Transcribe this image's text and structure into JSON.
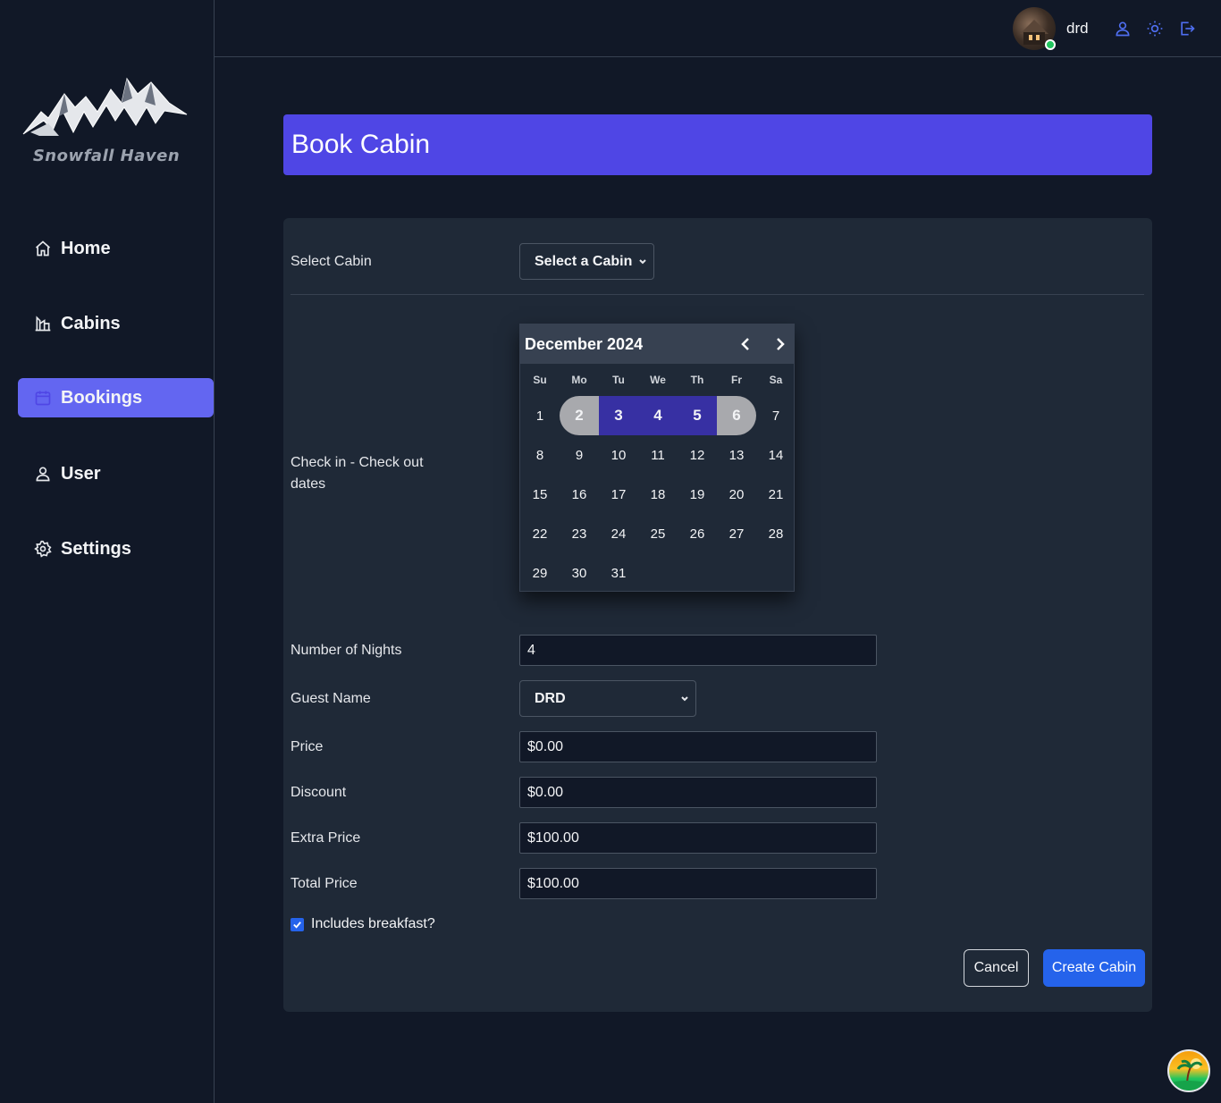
{
  "brand": {
    "name": "Snowfall Haven"
  },
  "sidebar": {
    "items": [
      {
        "label": "Home",
        "icon": "home-icon"
      },
      {
        "label": "Cabins",
        "icon": "cabins-icon"
      },
      {
        "label": "Bookings",
        "icon": "calendar-icon",
        "active": true
      },
      {
        "label": "User",
        "icon": "user-icon"
      },
      {
        "label": "Settings",
        "icon": "gear-icon"
      }
    ]
  },
  "header": {
    "username": "drd",
    "status": "online",
    "icons": [
      "user-icon",
      "sun-icon",
      "logout-icon"
    ]
  },
  "page": {
    "title": "Book Cabin"
  },
  "form": {
    "cabin": {
      "label": "Select Cabin",
      "value": "Select a Cabin"
    },
    "dates": {
      "label": "Check in - Check out dates"
    },
    "nights": {
      "label": "Number of Nights",
      "value": "4"
    },
    "guest": {
      "label": "Guest Name",
      "value": "DRD"
    },
    "price": {
      "label": "Price",
      "value": "$0.00"
    },
    "discount": {
      "label": "Discount",
      "value": "$0.00"
    },
    "extra_price": {
      "label": "Extra Price",
      "value": "$100.00"
    },
    "total_price": {
      "label": "Total Price",
      "value": "$100.00"
    },
    "breakfast": {
      "label": "Includes breakfast?",
      "checked": true
    },
    "cancel_label": "Cancel",
    "submit_label": "Create Cabin"
  },
  "calendar": {
    "month_label": "December 2024",
    "weekdays": [
      "Su",
      "Mo",
      "Tu",
      "We",
      "Th",
      "Fr",
      "Sa"
    ],
    "first_weekday_index": 0,
    "days_in_month": 31,
    "range_start": 2,
    "range_end": 6
  },
  "colors": {
    "accent": "#4f46e5",
    "active_nav": "#6366f1",
    "primary_button": "#2563eb",
    "range": "#3730a3",
    "range_ends": "#a8a9ad",
    "background": "#111827",
    "card": "#1f2937"
  }
}
